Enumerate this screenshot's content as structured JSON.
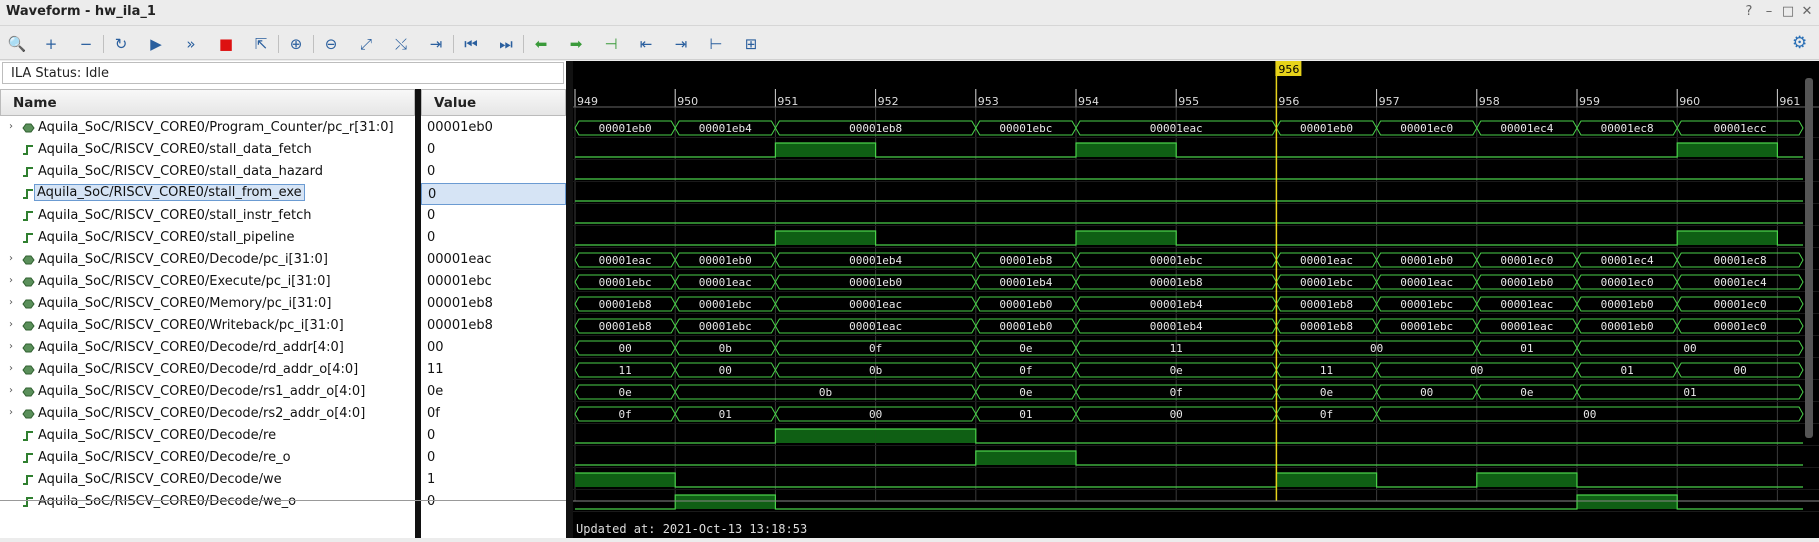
{
  "window": {
    "title": "Waveform - hw_ila_1",
    "controls": [
      "?",
      "–",
      "□",
      "✕"
    ]
  },
  "toolbar": {
    "buttons": [
      {
        "name": "search-icon",
        "glyph": "🔍"
      },
      {
        "name": "add-icon",
        "glyph": "+"
      },
      {
        "name": "remove-icon",
        "glyph": "−"
      },
      {
        "name": "refresh-icon",
        "glyph": "↻"
      },
      {
        "name": "run-trigger-icon",
        "glyph": "▶"
      },
      {
        "name": "run-immediate-icon",
        "glyph": "»"
      },
      {
        "name": "stop-icon",
        "glyph": "■"
      },
      {
        "name": "export-icon",
        "glyph": "⇱"
      },
      {
        "name": "zoom-in-icon",
        "glyph": "⊕"
      },
      {
        "name": "zoom-out-icon",
        "glyph": "⊖"
      },
      {
        "name": "zoom-fit-icon",
        "glyph": "⤢"
      },
      {
        "name": "cursor-snap-icon",
        "glyph": "⤯"
      },
      {
        "name": "go-cursor-icon",
        "glyph": "⇥"
      },
      {
        "name": "go-start-icon",
        "glyph": "⏮"
      },
      {
        "name": "go-end-icon",
        "glyph": "⏭"
      },
      {
        "name": "prev-transition-icon",
        "glyph": "⬅"
      },
      {
        "name": "next-transition-icon",
        "glyph": "➡"
      },
      {
        "name": "add-marker-icon",
        "glyph": "⊣"
      },
      {
        "name": "prev-marker-icon",
        "glyph": "⇤"
      },
      {
        "name": "next-marker-icon",
        "glyph": "⇥"
      },
      {
        "name": "swap-cursors-icon",
        "glyph": "⊢"
      },
      {
        "name": "expand-icon",
        "glyph": "⊞"
      }
    ],
    "settings_glyph": "⚙"
  },
  "status": {
    "text": "ILA Status: Idle"
  },
  "columns": {
    "name": "Name",
    "value": "Value"
  },
  "signals": [
    {
      "name": "Aquila_SoC/RISCV_CORE0/Program_Counter/pc_r[31:0]",
      "value": "00001eb0",
      "bus": true
    },
    {
      "name": "Aquila_SoC/RISCV_CORE0/stall_data_fetch",
      "value": "0",
      "bus": false
    },
    {
      "name": "Aquila_SoC/RISCV_CORE0/stall_data_hazard",
      "value": "0",
      "bus": false
    },
    {
      "name": "Aquila_SoC/RISCV_CORE0/stall_from_exe",
      "value": "0",
      "bus": false,
      "selected": true
    },
    {
      "name": "Aquila_SoC/RISCV_CORE0/stall_instr_fetch",
      "value": "0",
      "bus": false
    },
    {
      "name": "Aquila_SoC/RISCV_CORE0/stall_pipeline",
      "value": "0",
      "bus": false
    },
    {
      "name": "Aquila_SoC/RISCV_CORE0/Decode/pc_i[31:0]",
      "value": "00001eac",
      "bus": true
    },
    {
      "name": "Aquila_SoC/RISCV_CORE0/Execute/pc_i[31:0]",
      "value": "00001ebc",
      "bus": true
    },
    {
      "name": "Aquila_SoC/RISCV_CORE0/Memory/pc_i[31:0]",
      "value": "00001eb8",
      "bus": true
    },
    {
      "name": "Aquila_SoC/RISCV_CORE0/Writeback/pc_i[31:0]",
      "value": "00001eb8",
      "bus": true
    },
    {
      "name": "Aquila_SoC/RISCV_CORE0/Decode/rd_addr[4:0]",
      "value": "00",
      "bus": true
    },
    {
      "name": "Aquila_SoC/RISCV_CORE0/Decode/rd_addr_o[4:0]",
      "value": "11",
      "bus": true
    },
    {
      "name": "Aquila_SoC/RISCV_CORE0/Decode/rs1_addr_o[4:0]",
      "value": "0e",
      "bus": true
    },
    {
      "name": "Aquila_SoC/RISCV_CORE0/Decode/rs2_addr_o[4:0]",
      "value": "0f",
      "bus": true
    },
    {
      "name": "Aquila_SoC/RISCV_CORE0/Decode/re",
      "value": "0",
      "bus": false
    },
    {
      "name": "Aquila_SoC/RISCV_CORE0/Decode/re_o",
      "value": "0",
      "bus": false
    },
    {
      "name": "Aquila_SoC/RISCV_CORE0/Decode/we",
      "value": "1",
      "bus": false
    },
    {
      "name": "Aquila_SoC/RISCV_CORE0/Decode/we_o",
      "value": "0",
      "bus": false
    }
  ],
  "timeline": {
    "ticks": [
      "949",
      "950",
      "951",
      "952",
      "953",
      "954",
      "955",
      "956",
      "957",
      "958",
      "959",
      "960",
      "961"
    ],
    "cursor_label": "956",
    "cursor_sample": 956,
    "first_sample": 949
  },
  "waves": [
    {
      "type": "bus",
      "segments": [
        [
          "00001eb0",
          1
        ],
        [
          "00001eb4",
          1
        ],
        [
          "00001eb8",
          2
        ],
        [
          "00001ebc",
          1
        ],
        [
          "00001eac",
          2
        ],
        [
          "00001eb0",
          1
        ],
        [
          "00001ec0",
          1
        ],
        [
          "00001ec4",
          1
        ],
        [
          "00001ec8",
          1
        ],
        [
          "00001ecc",
          1.3
        ]
      ]
    },
    {
      "type": "bit",
      "bits": [
        0,
        0,
        1,
        0,
        0,
        1,
        0,
        0,
        0,
        0,
        0,
        1,
        0
      ]
    },
    {
      "type": "bit",
      "bits": [
        0,
        0,
        0,
        0,
        0,
        0,
        0,
        0,
        0,
        0,
        0,
        0,
        0
      ]
    },
    {
      "type": "bit",
      "bits": [
        0,
        0,
        0,
        0,
        0,
        0,
        0,
        0,
        0,
        0,
        0,
        0,
        0
      ]
    },
    {
      "type": "bit",
      "bits": [
        0,
        0,
        0,
        0,
        0,
        0,
        0,
        0,
        0,
        0,
        0,
        0,
        0
      ]
    },
    {
      "type": "bit",
      "bits": [
        0,
        0,
        1,
        0,
        0,
        1,
        0,
        0,
        0,
        0,
        0,
        1,
        0
      ]
    },
    {
      "type": "bus",
      "segments": [
        [
          "00001eac",
          1
        ],
        [
          "00001eb0",
          1
        ],
        [
          "00001eb4",
          2
        ],
        [
          "00001eb8",
          1
        ],
        [
          "00001ebc",
          2
        ],
        [
          "00001eac",
          1
        ],
        [
          "00001eb0",
          1
        ],
        [
          "00001ec0",
          1
        ],
        [
          "00001ec4",
          1
        ],
        [
          "00001ec8",
          1.3
        ]
      ]
    },
    {
      "type": "bus",
      "segments": [
        [
          "00001ebc",
          1
        ],
        [
          "00001eac",
          1
        ],
        [
          "00001eb0",
          2
        ],
        [
          "00001eb4",
          1
        ],
        [
          "00001eb8",
          2
        ],
        [
          "00001ebc",
          1
        ],
        [
          "00001eac",
          1
        ],
        [
          "00001eb0",
          1
        ],
        [
          "00001ec0",
          1
        ],
        [
          "00001ec4",
          1.3
        ]
      ]
    },
    {
      "type": "bus",
      "segments": [
        [
          "00001eb8",
          1
        ],
        [
          "00001ebc",
          1
        ],
        [
          "00001eac",
          2
        ],
        [
          "00001eb0",
          1
        ],
        [
          "00001eb4",
          2
        ],
        [
          "00001eb8",
          1
        ],
        [
          "00001ebc",
          1
        ],
        [
          "00001eac",
          1
        ],
        [
          "00001eb0",
          1
        ],
        [
          "00001ec0",
          1.3
        ]
      ]
    },
    {
      "type": "bus",
      "segments": [
        [
          "00001eb8",
          1
        ],
        [
          "00001ebc",
          1
        ],
        [
          "00001eac",
          2
        ],
        [
          "00001eb0",
          1
        ],
        [
          "00001eb4",
          2
        ],
        [
          "00001eb8",
          1
        ],
        [
          "00001ebc",
          1
        ],
        [
          "00001eac",
          1
        ],
        [
          "00001eb0",
          1
        ],
        [
          "00001ec0",
          1.3
        ]
      ]
    },
    {
      "type": "bus",
      "segments": [
        [
          "00",
          1
        ],
        [
          "0b",
          1
        ],
        [
          "0f",
          2
        ],
        [
          "0e",
          1
        ],
        [
          "11",
          2
        ],
        [
          "00",
          2
        ],
        [
          "01",
          1
        ],
        [
          "00",
          3.3
        ]
      ]
    },
    {
      "type": "bus",
      "segments": [
        [
          "11",
          1
        ],
        [
          "00",
          1
        ],
        [
          "0b",
          2
        ],
        [
          "0f",
          1
        ],
        [
          "0e",
          2
        ],
        [
          "11",
          1
        ],
        [
          "00",
          2
        ],
        [
          "01",
          1
        ],
        [
          "00",
          2.3
        ]
      ]
    },
    {
      "type": "bus",
      "segments": [
        [
          "0e",
          1
        ],
        [
          "0b",
          3
        ],
        [
          "0e",
          1
        ],
        [
          "0f",
          2
        ],
        [
          "0e",
          1
        ],
        [
          "00",
          1
        ],
        [
          "0e",
          1
        ],
        [
          "01",
          3.3
        ]
      ]
    },
    {
      "type": "bus",
      "segments": [
        [
          "0f",
          1
        ],
        [
          "01",
          1
        ],
        [
          "00",
          2
        ],
        [
          "01",
          1
        ],
        [
          "00",
          2
        ],
        [
          "0f",
          1
        ],
        [
          "00",
          5.3
        ]
      ]
    },
    {
      "type": "bit",
      "bits": [
        0,
        0,
        1,
        1,
        0,
        0,
        0,
        0,
        0,
        0,
        0,
        0,
        0
      ]
    },
    {
      "type": "bit",
      "bits": [
        0,
        0,
        0,
        0,
        1,
        0,
        0,
        0,
        0,
        0,
        0,
        0,
        0
      ]
    },
    {
      "type": "bit",
      "bits": [
        1,
        0,
        0,
        0,
        0,
        0,
        0,
        1,
        0,
        1,
        0,
        0,
        0
      ]
    },
    {
      "type": "bit",
      "bits": [
        0,
        1,
        0,
        0,
        0,
        0,
        0,
        0,
        0,
        0,
        1,
        0,
        0
      ]
    }
  ],
  "footer": {
    "updated": "Updated at:  2021-Oct-13 13:18:53"
  }
}
